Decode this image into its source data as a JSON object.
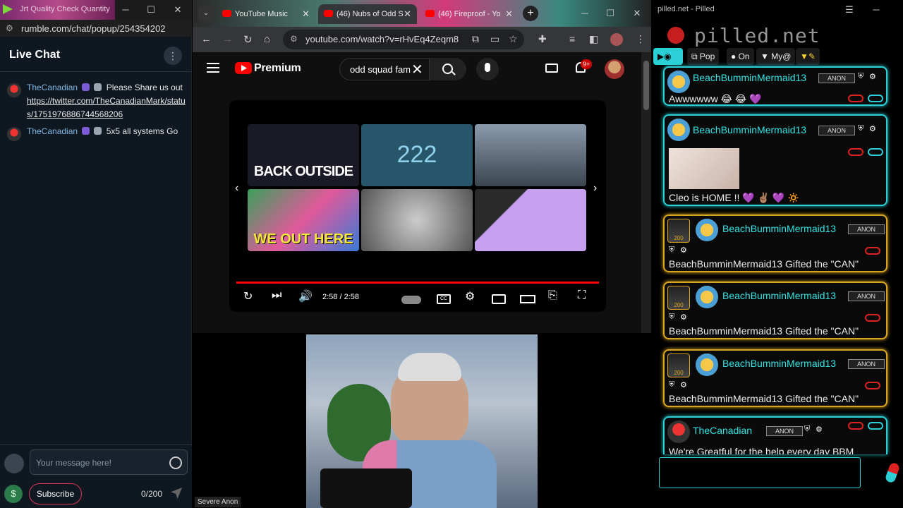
{
  "rumble": {
    "window_title": "Jrt Quality Check Quantity",
    "url": "rumble.com/chat/popup/254354202",
    "header_title": "Live Chat",
    "messages": [
      {
        "user": "TheCanadian",
        "text": "Please Share us out",
        "link": "https://twitter.com/TheCanadianMark/status/1751976886744568206"
      },
      {
        "user": "TheCanadian",
        "text": "5x5 all systems Go"
      }
    ],
    "input_placeholder": "Your message here!",
    "subscribe_label": "Subscribe",
    "char_count": "0/200",
    "dollar_icon": "$"
  },
  "chrome": {
    "tabs": [
      {
        "label": "YouTube Music",
        "active": false
      },
      {
        "label": "(46) Nubs of Odd S",
        "active": true
      },
      {
        "label": "(46) Fireproof - Yo",
        "active": false
      }
    ],
    "url": "youtube.com/watch?v=rHvEq4Zeqm8",
    "new_tab_label": "+"
  },
  "youtube": {
    "brand": "Premium",
    "search_value": "odd squad fam",
    "notification_count": "9+",
    "thumbnails": [
      {
        "caption": "BACK OUTSIDE",
        "bg": "#1c1c2a"
      },
      {
        "caption": "222",
        "bg": "#1f4f68"
      },
      {
        "caption": "",
        "bg": "#4a5a6a"
      },
      {
        "caption": "WE OUT HERE",
        "bg": "#3a7a3a"
      },
      {
        "caption": "",
        "bg": "#6e6e6e"
      },
      {
        "caption": "",
        "bg": "#9a7ad8"
      }
    ],
    "time": "2:58 / 2:58",
    "progress": 1.0
  },
  "cam": {
    "label": "Severe Anon"
  },
  "pilled": {
    "window_title": "pilled.net - Pilled",
    "brand": "pilled.net",
    "buttons": [
      "Pop",
      "On",
      "My@"
    ],
    "posts": [
      {
        "user": "BeachBumminMermaid13",
        "text": "Awwwwww 😂 😂 💜",
        "style": "cyan",
        "gift": false
      },
      {
        "user": "BeachBumminMermaid13",
        "text": "Cleo is HOME !! 💜 ✌🏽 💜 🔅",
        "style": "cyan",
        "gift": false,
        "image": true
      },
      {
        "user": "BeachBumminMermaid13",
        "text": "BeachBumminMermaid13 Gifted the \"CAN\"",
        "style": "gold",
        "gift": true,
        "can": "200"
      },
      {
        "user": "BeachBumminMermaid13",
        "text": "BeachBumminMermaid13 Gifted the \"CAN\"",
        "style": "gold",
        "gift": true,
        "can": "200"
      },
      {
        "user": "BeachBumminMermaid13",
        "text": "BeachBumminMermaid13 Gifted the \"CAN\"",
        "style": "gold",
        "gift": true,
        "can": "200"
      },
      {
        "user": "TheCanadian",
        "text": "We're Greatful for the help every day BBM",
        "style": "cyan",
        "gift": false
      }
    ],
    "anon_tag": "ANON"
  },
  "colors": {
    "youtube_red": "#ff0000",
    "pilled_cyan": "#2ad0d6",
    "pilled_gold": "#d9a520",
    "rumble_subscribe": "#e0365a"
  }
}
